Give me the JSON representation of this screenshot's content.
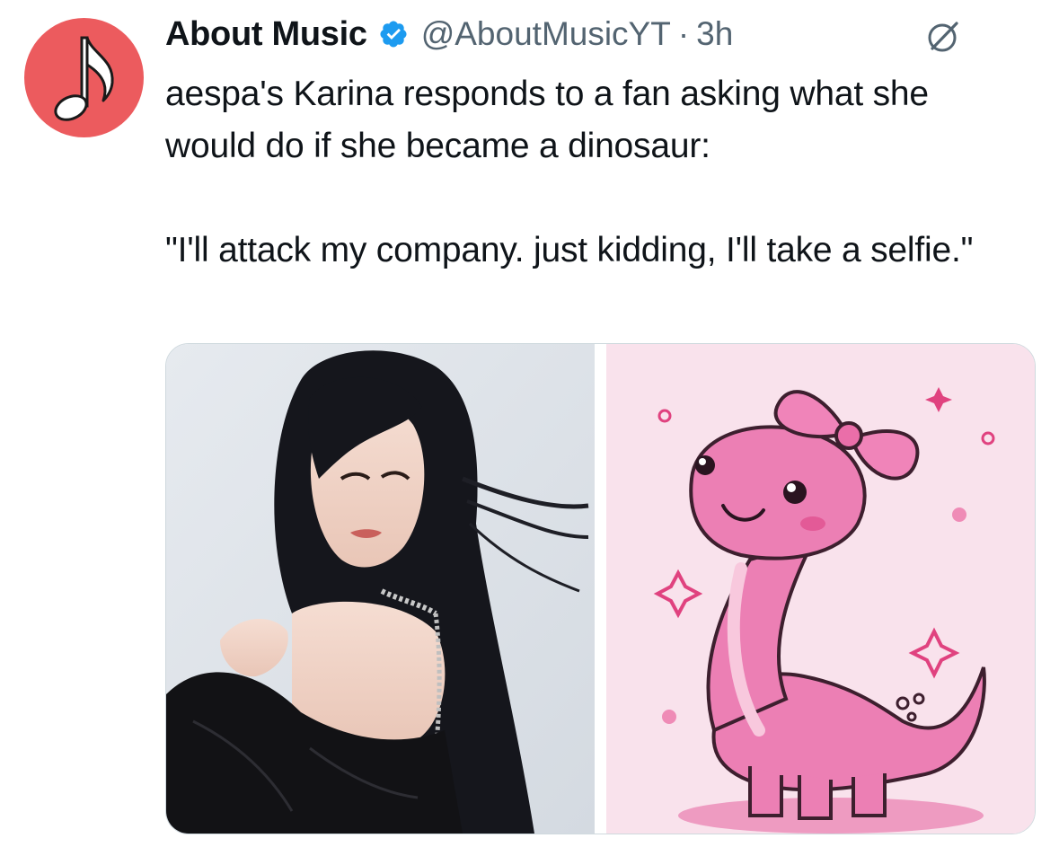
{
  "tweet": {
    "display_name": "About Music",
    "handle": "@AboutMusicYT",
    "separator": "·",
    "time": "3h",
    "text": "aespa's Karina responds to a fan asking what she would do if she became a dinosaur:\n\n\"I'll attack my company. just kidding, I'll take a selfie.\""
  },
  "icons": {
    "avatar": "music-note-icon",
    "verified": "verified-badge-icon",
    "grok": "grok-icon"
  },
  "colors": {
    "avatar_bg": "#ec5b5e",
    "verified": "#1d9bf0",
    "secondary_text": "#536471",
    "dino_pink": "#e879ad"
  }
}
